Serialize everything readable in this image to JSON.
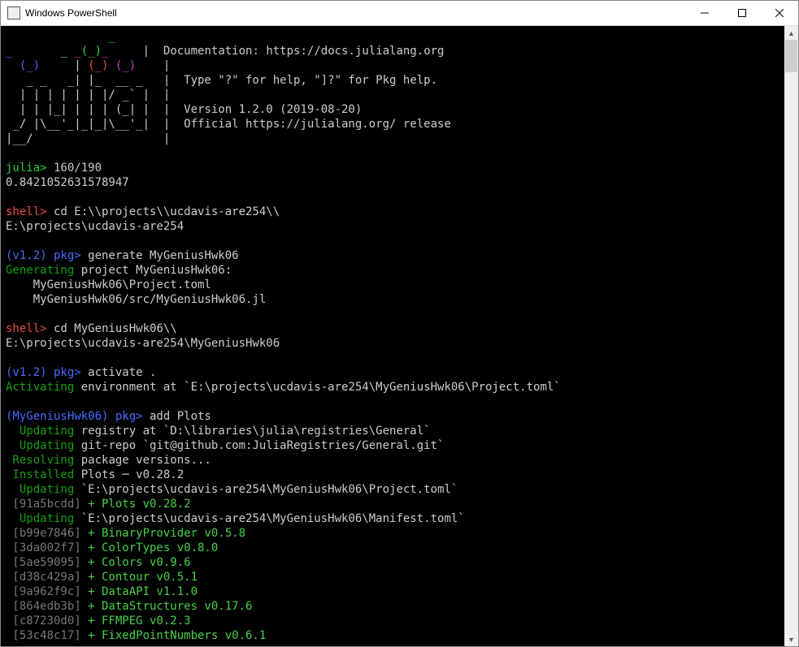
{
  "titlebar": {
    "title": "Windows PowerShell"
  },
  "colors": {
    "bg": "#000000",
    "fg": "#cccccc",
    "green": "#2ecc40",
    "red": "#e74c3c",
    "blue": "#4a6aff",
    "gray": "#777777"
  },
  "banner": {
    "l1a": "               ",
    "l1b": "_",
    "l2a": "   ",
    "l2b": "_",
    "l2c": "       _ ",
    "l2d": "_",
    "l2e": "(_)",
    "l2f": "_",
    "l2g": "     |  Documentation: https://docs.julialang.org",
    "l3a": "  ",
    "l3b": "(_)",
    "l3c": "     | ",
    "l3d": "(_)",
    "l3e": " ",
    "l3f": "(_)",
    "l3g": "    |",
    "l4": "   _ _   _| |_  __ _   |  Type \"?\" for help, \"]?\" for Pkg help.",
    "l5": "  | | | | | | |/ _` |  |",
    "l6": "  | | |_| | | | (_| |  |  Version 1.2.0 (2019-08-20)",
    "l7": " _/ |\\__'_|_|_|\\__'_|  |  Official https://julialang.org/ release",
    "l8": "|__/                   |"
  },
  "session": {
    "p1_prompt": "julia>",
    "p1_cmd": " 160/190",
    "p1_out": "0.8421052631578947",
    "p2_prompt": "shell>",
    "p2_cmd": " cd E:\\\\projects\\\\ucdavis-are254\\\\",
    "p2_out": "E:\\projects\\ucdavis-are254",
    "p3_prompt": "(v1.2) pkg>",
    "p3_cmd": " generate MyGeniusHwk06",
    "p3_out1a": "Generating",
    "p3_out1b": " project MyGeniusHwk06:",
    "p3_out2": "    MyGeniusHwk06\\Project.toml",
    "p3_out3": "    MyGeniusHwk06/src/MyGeniusHwk06.jl",
    "p4_prompt": "shell>",
    "p4_cmd": " cd MyGeniusHwk06\\\\",
    "p4_out": "E:\\projects\\ucdavis-are254\\MyGeniusHwk06",
    "p5_prompt": "(v1.2) pkg>",
    "p5_cmd": " activate .",
    "p5_out_a": "Activating",
    "p5_out_b": " environment at `E:\\projects\\ucdavis-are254\\MyGeniusHwk06\\Project.toml`",
    "p6_prompt": "(MyGeniusHwk06) pkg>",
    "p6_cmd": " add Plots",
    "p6_l1a": "  Updating",
    "p6_l1b": " registry at `D:\\libraries\\julia\\registries\\General`",
    "p6_l2a": "  Updating",
    "p6_l2b": " git-repo `git@github.com:JuliaRegistries/General.git`",
    "p6_l3a": " Resolving",
    "p6_l3b": " package versions...",
    "p6_l4a": " Installed",
    "p6_l4b": " Plots ─ v0.28.2",
    "p6_l5a": "  Updating",
    "p6_l5b": " `E:\\projects\\ucdavis-are254\\MyGeniusHwk06\\Project.toml`",
    "p6_l6a": " [91a5bcdd]",
    "p6_l6b": " + Plots v0.28.2",
    "p6_l7a": "  Updating",
    "p6_l7b": " `E:\\projects\\ucdavis-are254\\MyGeniusHwk06\\Manifest.toml`",
    "p6_l8a": " [b99e7846]",
    "p6_l8b": " + BinaryProvider v0.5.8",
    "p6_l9a": " [3da002f7]",
    "p6_l9b": " + ColorTypes v0.8.0",
    "p6_l10a": " [5ae59095]",
    "p6_l10b": " + Colors v0.9.6",
    "p6_l11a": " [d38c429a]",
    "p6_l11b": " + Contour v0.5.1",
    "p6_l12a": " [9a962f9c]",
    "p6_l12b": " + DataAPI v1.1.0",
    "p6_l13a": " [864edb3b]",
    "p6_l13b": " + DataStructures v0.17.6",
    "p6_l14a": " [c87230d0]",
    "p6_l14b": " + FFMPEG v0.2.3",
    "p6_l15a": " [53c48c17]",
    "p6_l15b": " + FixedPointNumbers v0.6.1"
  }
}
